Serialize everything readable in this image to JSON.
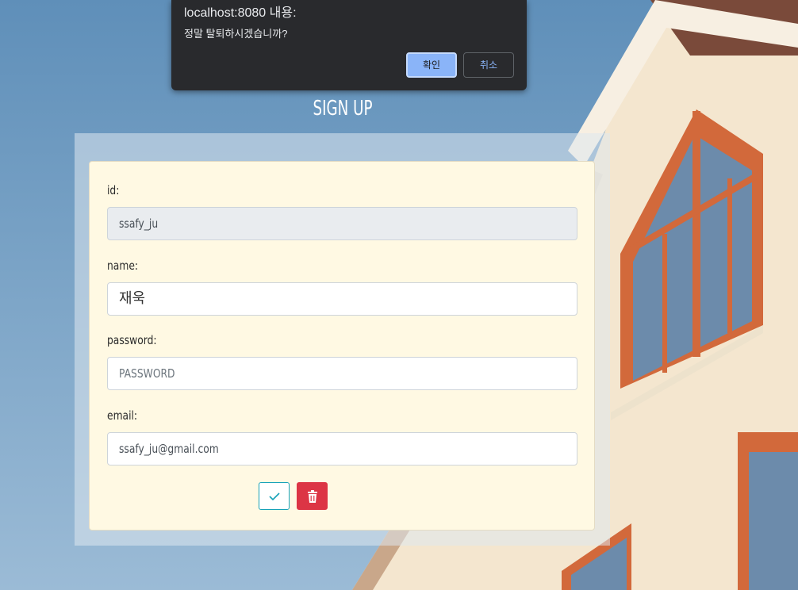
{
  "page": {
    "title": "SIGN UP"
  },
  "form": {
    "id_label": "id:",
    "id_value": "ssafy_ju",
    "name_label": "name:",
    "name_value": "재욱",
    "password_label": "password:",
    "password_placeholder": "PASSWORD",
    "email_label": "email:",
    "email_value": "ssafy_ju@gmail.com"
  },
  "buttons": {
    "confirm_icon": "check-icon",
    "delete_icon": "trash-icon"
  },
  "dialog": {
    "title": "localhost:8080 내용:",
    "message": "정말 탈퇴하시겠습니까?",
    "ok_label": "확인",
    "cancel_label": "취소"
  },
  "colors": {
    "accent_info": "#17a2b8",
    "danger": "#dc3545",
    "dialog_bg": "#292a2d",
    "dialog_primary": "#8ab4f8"
  }
}
